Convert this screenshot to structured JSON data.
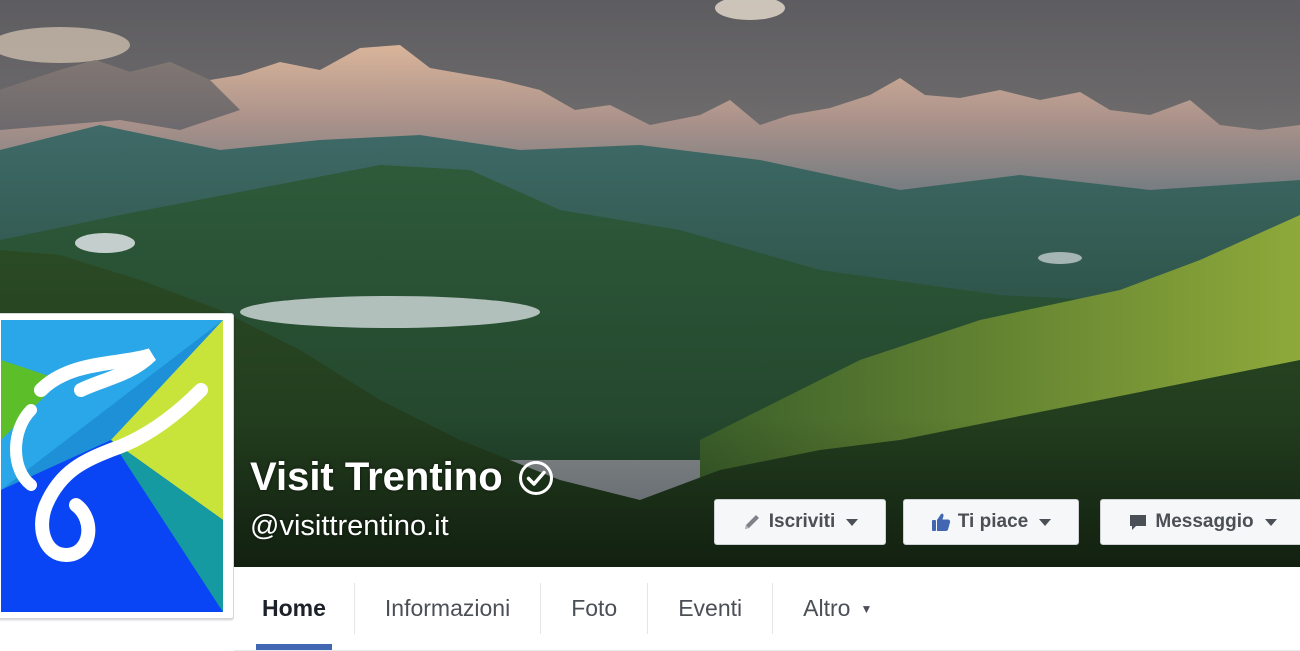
{
  "page": {
    "name": "Visit Trentino",
    "handle": "@visittrentino.it",
    "verified": true
  },
  "buttons": [
    {
      "label": "Iscriviti",
      "icon": "pencil-icon"
    },
    {
      "label": "Ti piace",
      "icon": "thumbs-up-icon"
    },
    {
      "label": "Messaggio",
      "icon": "message-icon"
    }
  ],
  "tabs": [
    {
      "label": "Home",
      "active": true
    },
    {
      "label": "Informazioni"
    },
    {
      "label": "Foto"
    },
    {
      "label": "Eventi"
    },
    {
      "label": "Altro",
      "has_menu": true
    }
  ],
  "colors": {
    "brand_blue": "#4267b2",
    "like_blue": "#4267b2",
    "logo_blue": "#0a45f5",
    "logo_green": "#c8e43a",
    "logo_teal": "#149aa0"
  }
}
